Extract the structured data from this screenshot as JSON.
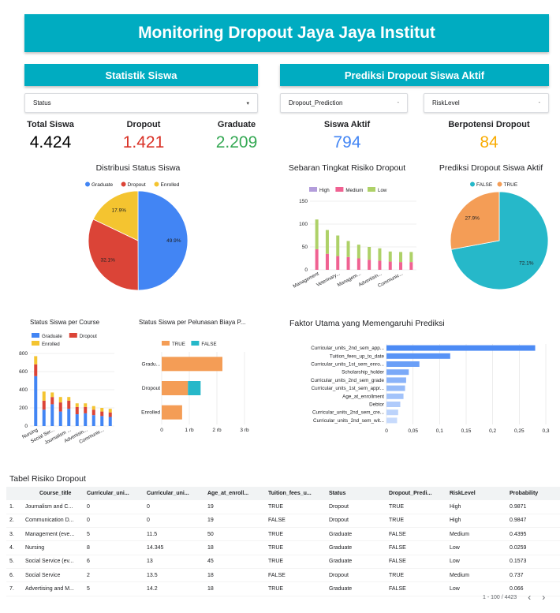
{
  "header": {
    "title": "Monitoring Dropout Jaya Jaya Institut"
  },
  "stats_section": {
    "title": "Statistik Siswa"
  },
  "prediction_section": {
    "title": "Prediksi Dropout Siswa Aktif"
  },
  "filters": {
    "status": "Status",
    "dropout_prediction": "Dropout_Prediction",
    "risk_level": "RiskLevel",
    "arrow": "▾",
    "dash": "-"
  },
  "kpis": [
    {
      "label": "Total Siswa",
      "value": "4.424",
      "color": "#000000"
    },
    {
      "label": "Dropout",
      "value": "1.421",
      "color": "#d93025"
    },
    {
      "label": "Graduate",
      "value": "2.209",
      "color": "#34a853"
    },
    {
      "label": "Siswa Aktif",
      "value": "794",
      "color": "#4285f4"
    },
    {
      "label": "Berpotensi Dropout",
      "value": "84",
      "color": "#f9ab00"
    }
  ],
  "colors": {
    "graduate": "#4285f4",
    "dropout": "#db4437",
    "enrolled": "#f4c430",
    "high": "#b39ddb",
    "medium": "#f06292",
    "low": "#aed168",
    "false": "#26b8c9",
    "true": "#f49d56",
    "bar_blue": "#4c8bf5",
    "header": "#00acc1"
  },
  "chart_data": [
    {
      "id": "distribusi",
      "type": "pie",
      "title": "Distribusi Status Siswa",
      "legend": [
        "Graduate",
        "Dropout",
        "Enrolled"
      ],
      "values": [
        49.9,
        32.1,
        17.9
      ],
      "labels": [
        "49.9%",
        "32.1%",
        "17.9%"
      ]
    },
    {
      "id": "sebaran",
      "type": "bar",
      "title": "Sebaran Tingkat Risiko Dropout",
      "legend": [
        "High",
        "Medium",
        "Low"
      ],
      "yticks": [
        "150",
        "100",
        "50",
        "0"
      ],
      "ylim": [
        0,
        150
      ],
      "xticks": [
        "Management",
        "Veterinary...",
        "Managem...",
        "Advertisin...",
        "Communic..."
      ],
      "stacks": [
        [
          0,
          45,
          65
        ],
        [
          0,
          35,
          52
        ],
        [
          0,
          30,
          45
        ],
        [
          0,
          28,
          35
        ],
        [
          0,
          25,
          30
        ],
        [
          0,
          22,
          28
        ],
        [
          0,
          20,
          27
        ],
        [
          0,
          18,
          22
        ],
        [
          0,
          17,
          22
        ],
        [
          0,
          17,
          22
        ]
      ]
    },
    {
      "id": "prediksi",
      "type": "pie",
      "title": "Prediksi Dropout Siswa Aktif",
      "legend": [
        "FALSE",
        "TRUE"
      ],
      "values": [
        72.1,
        27.9
      ],
      "labels": [
        "72.1%",
        "27.9%"
      ]
    },
    {
      "id": "percourse",
      "type": "bar",
      "title": "Status Siswa per Course",
      "legend": [
        "Graduate",
        "Dropout",
        "Enrolled"
      ],
      "yticks": [
        "800",
        "600",
        "400",
        "200",
        "0"
      ],
      "ylim": [
        0,
        800
      ],
      "xticks": [
        "Nursing",
        "Social Ser...",
        "Journalism ...",
        "Advertisin...",
        "Communic..."
      ],
      "stacks": [
        [
          550,
          130,
          90
        ],
        [
          180,
          100,
          100
        ],
        [
          240,
          80,
          50
        ],
        [
          160,
          100,
          60
        ],
        [
          190,
          90,
          40
        ],
        [
          130,
          80,
          40
        ],
        [
          140,
          70,
          40
        ],
        [
          120,
          60,
          40
        ],
        [
          110,
          50,
          40
        ],
        [
          100,
          50,
          40
        ]
      ]
    },
    {
      "id": "pelunasan",
      "type": "bar",
      "title": "Status Siswa per Pelunasan Biaya P...",
      "legend": [
        "TRUE",
        "FALSE"
      ],
      "categories": [
        "Gradu...",
        "Dropout",
        "Enrolled"
      ],
      "xticks": [
        "0",
        "1 rb",
        "2 rb",
        "3 rb"
      ],
      "xlim": [
        0,
        3000
      ],
      "series": [
        {
          "name": "TRUE",
          "values": [
            2200,
            950,
            740
          ]
        },
        {
          "name": "FALSE",
          "values": [
            0,
            460,
            0
          ]
        }
      ]
    },
    {
      "id": "faktor",
      "type": "bar",
      "title": "Faktor Utama yang Memengaruhi Prediksi",
      "categories": [
        "Curricular_units_2nd_sem_app...",
        "Tuition_fees_up_to_date",
        "Curricular_units_1st_sem_enro...",
        "Scholarship_holder",
        "Curricular_units_2nd_sem_grade",
        "Curricular_units_1st_sem_appr...",
        "Age_at_enrollment",
        "Debtor",
        "Curricular_units_2nd_sem_cre...",
        "Curricular_units_2nd_sem_wit..."
      ],
      "values": [
        0.28,
        0.12,
        0.062,
        0.042,
        0.037,
        0.035,
        0.032,
        0.026,
        0.022,
        0.02
      ],
      "xticks": [
        "0",
        "0,05",
        "0,1",
        "0,15",
        "0,2",
        "0,25",
        "0,3"
      ],
      "xlim": [
        0,
        0.3
      ]
    }
  ],
  "table": {
    "title": "Tabel Risiko Dropout",
    "columns": [
      "Course_title",
      "Curricular_uni...",
      "Curricular_uni...",
      "Age_at_enroll...",
      "Tuition_fees_u...",
      "Status",
      "Dropout_Predi...",
      "RiskLevel",
      "Probability"
    ],
    "rows": [
      [
        "1.",
        "Journalism and C...",
        "0",
        "0",
        "19",
        "TRUE",
        "Dropout",
        "TRUE",
        "High",
        "0.9871"
      ],
      [
        "2.",
        "Communication D...",
        "0",
        "0",
        "19",
        "FALSE",
        "Dropout",
        "TRUE",
        "High",
        "0.9847"
      ],
      [
        "3.",
        "Management (eve...",
        "5",
        "11.5",
        "50",
        "TRUE",
        "Graduate",
        "FALSE",
        "Medium",
        "0.4395"
      ],
      [
        "4.",
        "Nursing",
        "8",
        "14.345",
        "18",
        "TRUE",
        "Graduate",
        "FALSE",
        "Low",
        "0.0259"
      ],
      [
        "5.",
        "Social Service (ev...",
        "6",
        "13",
        "45",
        "TRUE",
        "Graduate",
        "FALSE",
        "Low",
        "0.1573"
      ],
      [
        "6.",
        "Social Service",
        "2",
        "13.5",
        "18",
        "FALSE",
        "Dropout",
        "TRUE",
        "Medium",
        "0.737"
      ],
      [
        "7.",
        "Advertising and M...",
        "5",
        "14.2",
        "18",
        "TRUE",
        "Graduate",
        "FALSE",
        "Low",
        "0.066"
      ]
    ],
    "pagination": "1 - 100 / 4423",
    "prev": "‹",
    "next": "›"
  }
}
